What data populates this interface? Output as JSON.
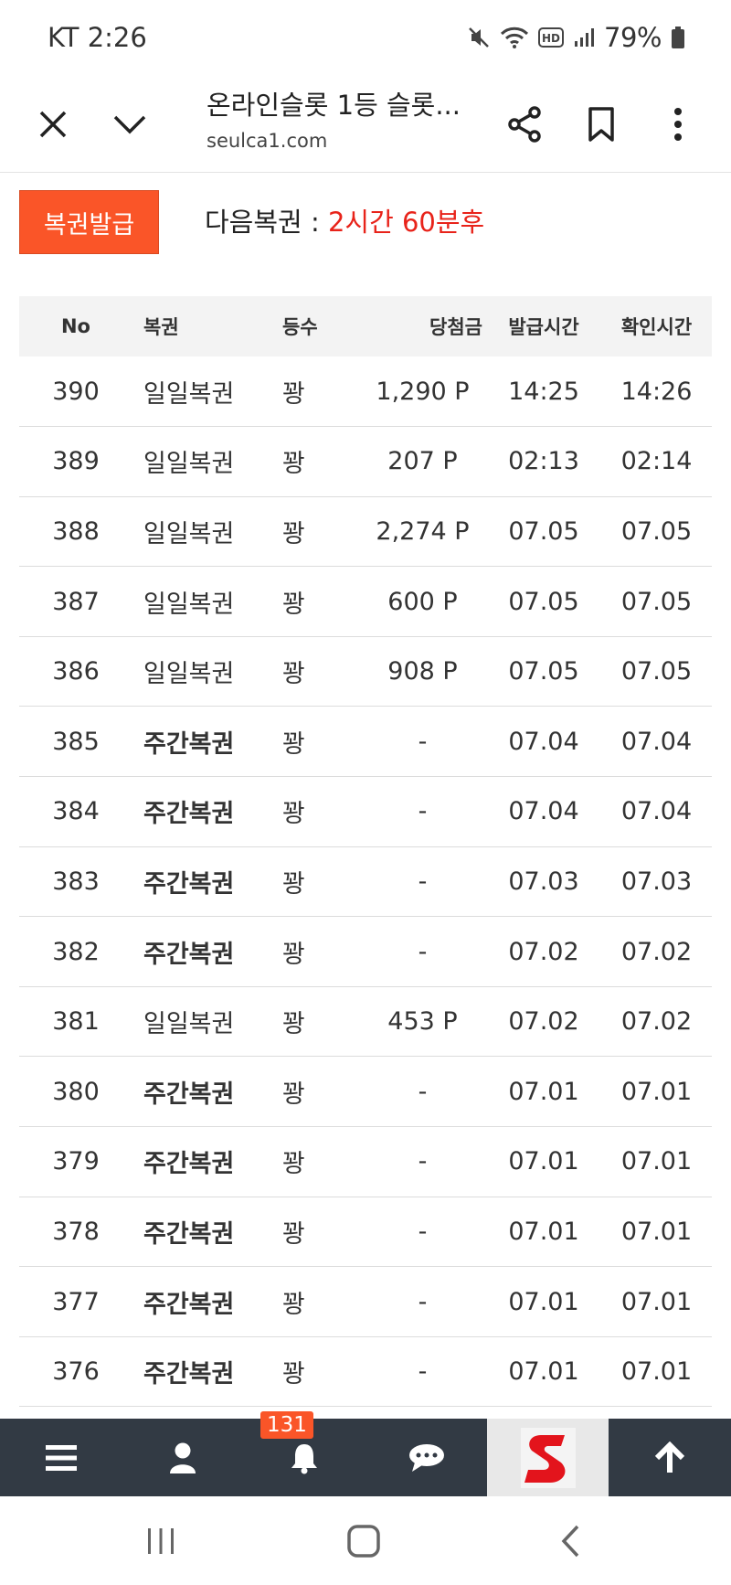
{
  "status_bar": {
    "carrier_time": "KT 2:26",
    "battery": "79%"
  },
  "browser": {
    "title": "온라인슬롯 1등 슬롯...",
    "url": "seulca1.com"
  },
  "lotto": {
    "issue_button": "복권발급",
    "next_label": "다음복권 : ",
    "next_value": "2시간 60분후"
  },
  "table": {
    "headers": [
      "No",
      "복권",
      "등수",
      "당첨금",
      "발급시간",
      "확인시간"
    ],
    "rows": [
      {
        "no": "390",
        "type": "일일복권",
        "rank": "꽝",
        "prize": "1,290 P",
        "issued": "14:25",
        "checked": "14:26"
      },
      {
        "no": "389",
        "type": "일일복권",
        "rank": "꽝",
        "prize": "207 P",
        "issued": "02:13",
        "checked": "02:14"
      },
      {
        "no": "388",
        "type": "일일복권",
        "rank": "꽝",
        "prize": "2,274 P",
        "issued": "07.05",
        "checked": "07.05"
      },
      {
        "no": "387",
        "type": "일일복권",
        "rank": "꽝",
        "prize": "600 P",
        "issued": "07.05",
        "checked": "07.05"
      },
      {
        "no": "386",
        "type": "일일복권",
        "rank": "꽝",
        "prize": "908 P",
        "issued": "07.05",
        "checked": "07.05"
      },
      {
        "no": "385",
        "type": "주간복권",
        "rank": "꽝",
        "prize": "-",
        "issued": "07.04",
        "checked": "07.04"
      },
      {
        "no": "384",
        "type": "주간복권",
        "rank": "꽝",
        "prize": "-",
        "issued": "07.04",
        "checked": "07.04"
      },
      {
        "no": "383",
        "type": "주간복권",
        "rank": "꽝",
        "prize": "-",
        "issued": "07.03",
        "checked": "07.03"
      },
      {
        "no": "382",
        "type": "주간복권",
        "rank": "꽝",
        "prize": "-",
        "issued": "07.02",
        "checked": "07.02"
      },
      {
        "no": "381",
        "type": "일일복권",
        "rank": "꽝",
        "prize": "453 P",
        "issued": "07.02",
        "checked": "07.02"
      },
      {
        "no": "380",
        "type": "주간복권",
        "rank": "꽝",
        "prize": "-",
        "issued": "07.01",
        "checked": "07.01"
      },
      {
        "no": "379",
        "type": "주간복권",
        "rank": "꽝",
        "prize": "-",
        "issued": "07.01",
        "checked": "07.01"
      },
      {
        "no": "378",
        "type": "주간복권",
        "rank": "꽝",
        "prize": "-",
        "issued": "07.01",
        "checked": "07.01"
      },
      {
        "no": "377",
        "type": "주간복권",
        "rank": "꽝",
        "prize": "-",
        "issued": "07.01",
        "checked": "07.01"
      },
      {
        "no": "376",
        "type": "주간복권",
        "rank": "꽝",
        "prize": "-",
        "issued": "07.01",
        "checked": "07.01"
      }
    ]
  },
  "bottom_nav": {
    "items": [
      "menu-icon",
      "user-icon",
      "bell-icon",
      "chat-icon",
      "site-logo",
      "arrow-up-icon"
    ],
    "notification_count": "131"
  },
  "colors": {
    "accent": "#fa5528",
    "highlight_red": "#e8231a",
    "nav_bg": "#323a44"
  }
}
